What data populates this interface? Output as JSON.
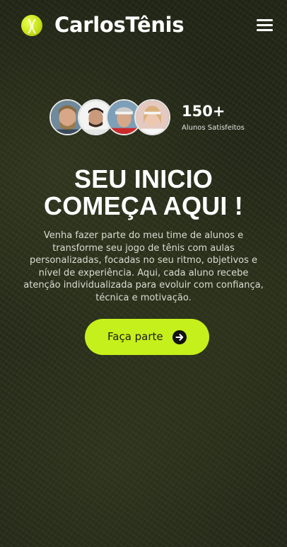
{
  "header": {
    "brand": "CarlosTênis",
    "logo_icon": "tennis-ball-icon",
    "menu_icon": "hamburger-menu-icon"
  },
  "students": {
    "count": "150+",
    "label": "Alunos Satisfeitos",
    "avatars": [
      "student-1",
      "student-2",
      "student-3",
      "student-4"
    ]
  },
  "hero": {
    "headline_line1": "SEU INICIO",
    "headline_line2": "COMEÇA AQUI !",
    "description": "Venha fazer parte do meu time de alunos e transforme seu jogo de tênis com aulas personalizadas, focadas no seu ritmo, objetivos e nível de experiência. Aqui, cada aluno recebe atenção individualizada para evoluir com confiança, técnica e motivação.",
    "cta_label": "Faça parte",
    "cta_icon": "arrow-right-circle-icon"
  },
  "colors": {
    "accent": "#c6f01b",
    "background": "#2c321d",
    "text": "#ffffff"
  }
}
